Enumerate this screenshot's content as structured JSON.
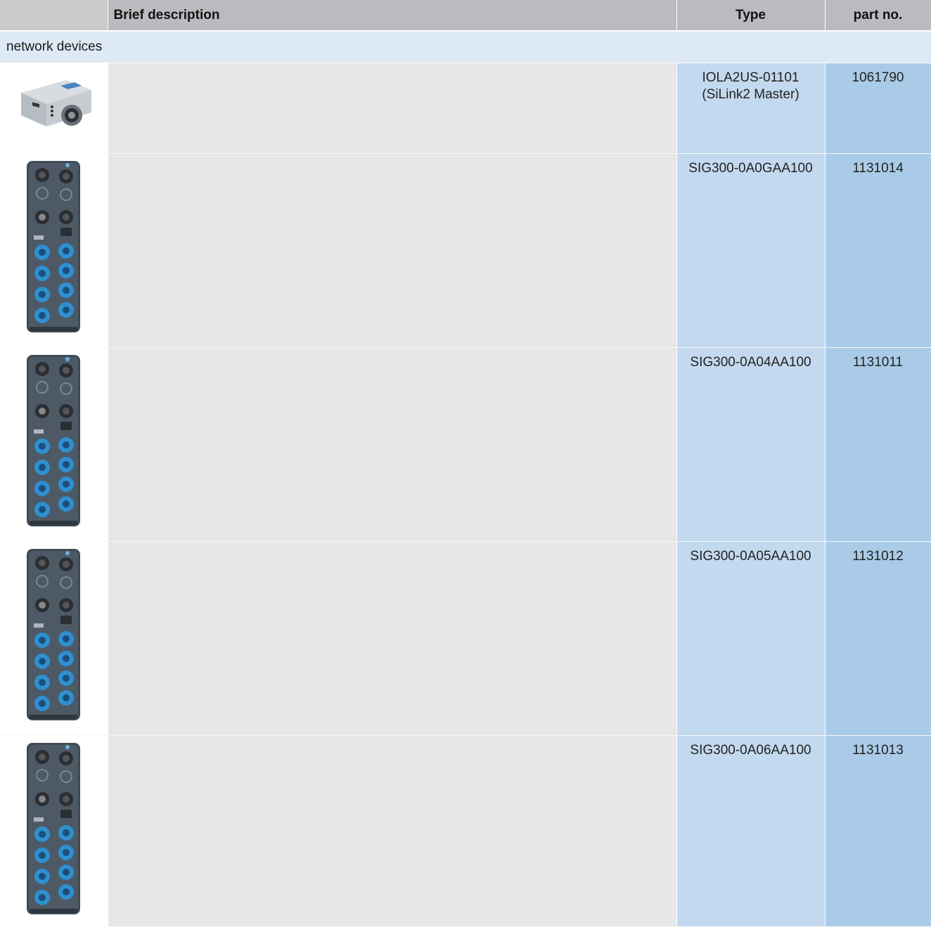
{
  "header": {
    "col_image": "",
    "col_description": "Brief description",
    "col_type": "Type",
    "col_part": "part no."
  },
  "group": {
    "label": "network devices"
  },
  "rows": [
    {
      "image_icon": "silink2-master-device-icon",
      "description": "",
      "type_lines": [
        "IOLA2US-01101",
        "(SiLink2 Master)"
      ],
      "part_no": "1061790"
    },
    {
      "image_icon": "sig300-io-module-icon",
      "description": "",
      "type_lines": [
        "SIG300-0A0GAA100"
      ],
      "part_no": "1131014"
    },
    {
      "image_icon": "sig300-io-module-icon",
      "description": "",
      "type_lines": [
        "SIG300-0A04AA100"
      ],
      "part_no": "1131011"
    },
    {
      "image_icon": "sig300-io-module-icon",
      "description": "",
      "type_lines": [
        "SIG300-0A05AA100"
      ],
      "part_no": "1131012"
    },
    {
      "image_icon": "sig300-io-module-icon",
      "description": "",
      "type_lines": [
        "SIG300-0A06AA100"
      ],
      "part_no": "1131013"
    }
  ],
  "colors": {
    "header_bg": "#b9bbbe",
    "group_bg": "#dde9f4",
    "desc_bg": "#e6e7e9",
    "type_bg": "#c3d9ef",
    "part_bg": "#a9cbe7",
    "connector_blue": "#2f8fd0"
  }
}
